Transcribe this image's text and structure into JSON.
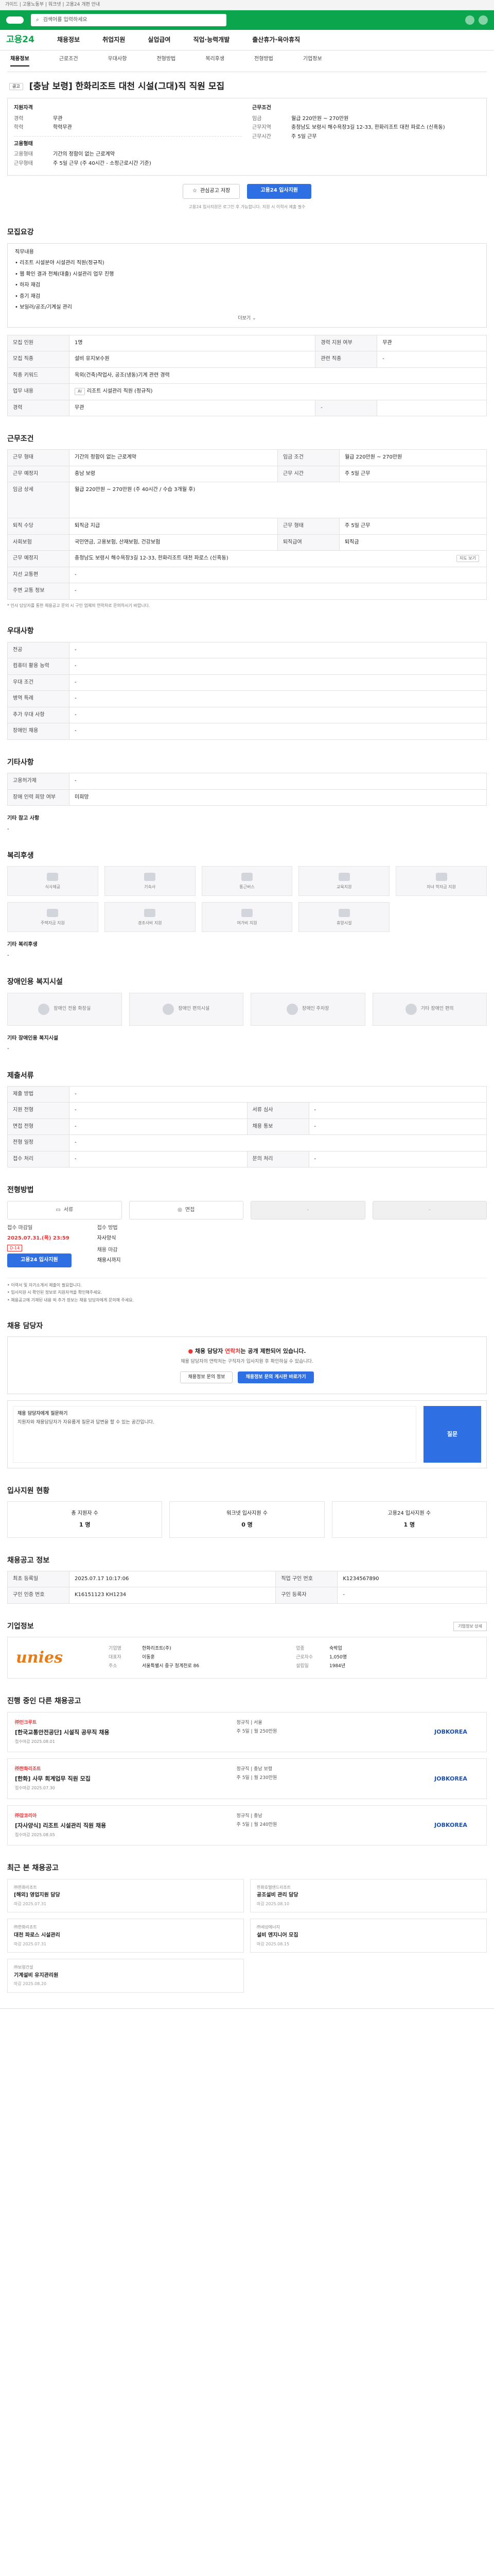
{
  "topbar": {
    "text": "가이드 | 고용노동부 | 워크넷 | 고용24 개편 안내"
  },
  "gnb": {
    "search_placeholder": "검색어를 입력하세요"
  },
  "nav": {
    "brand": "고용24",
    "items": [
      "채용정보",
      "취업지원",
      "실업급여",
      "직업·능력개발",
      "출산휴가·육아휴직"
    ]
  },
  "tabs": [
    "채용정보",
    "근로조건",
    "우대사항",
    "전형방법",
    "복리후생",
    "전형방법",
    "기업정보"
  ],
  "job": {
    "badge": "공고",
    "title": "[충남 보령] 한화리조트 대천 시설(그대)직 직원 모집",
    "left": {
      "heading": "지원자격",
      "rows": [
        [
          "경력",
          "무관"
        ],
        [
          "학력",
          "학력무관"
        ]
      ],
      "heading2": "고용형태",
      "rows2": [
        [
          "고용형태",
          "기간의 정함이 없는 근로계약"
        ],
        [
          "근무형태",
          "주 5일 근무 (주 40시간 - 소정근로시간 기준)"
        ]
      ]
    },
    "right": {
      "heading": "근무조건",
      "rows": [
        [
          "임금",
          "월급 220만원 ~ 270만원"
        ],
        [
          "근무지역",
          "충청남도 보령시 해수욕장3길 12-33, 한화리조트 대천 파로스 (신흑동)"
        ],
        [
          "근무시간",
          "주 5일 근무"
        ]
      ]
    }
  },
  "actions": {
    "save": "관심공고 저장",
    "apply": "고용24 입사지원"
  },
  "notice_line": "고용24 입사지원은 로그인 후 가능합니다. 지원 시 이력서 제출 필수",
  "recruit": {
    "title": "모집요강",
    "bullets": [
      "직무내용",
      "• 리조트 시설분야 시설관리 직원(정규직)",
      "• 웹 확인 결과 전체(대출) 시설관리 업무 진행",
      "• 하자 재검",
      "• 증기 재검",
      "• 보일러/공조/기계실 관리"
    ],
    "more": "더보기",
    "table": [
      [
        "모집 인원",
        "1명",
        "경력 지원 여부",
        "무관"
      ],
      [
        "모집 직종",
        "설비 유지보수원",
        "관련 직종",
        "-"
      ],
      [
        "직종 키워드",
        "옥외(건축)작업사, 공조(냉동)기계 관련 경력",
        null,
        null
      ],
      [
        "업무 내용",
        "리조트 시설관리 직원 (정규직)",
        null,
        null
      ],
      [
        "경력",
        "무관",
        "-",
        null
      ]
    ]
  },
  "cond": {
    "title": "근무조건",
    "rows": [
      [
        "근무 형태",
        "기간의 정함이 없는 근로계약",
        "임금 조건",
        "월급 220만원 ~ 270만원"
      ],
      [
        "근무 예정지",
        "충남 보령",
        "근무 시간",
        "주 5일 근무"
      ],
      [
        "임금 상세",
        "월급 220만원 ~ 270만원 (주 40시간 / 수습 3개월 후)",
        null,
        null
      ],
      [
        "퇴직 수당",
        "퇴직금 지급",
        "근무 형태",
        "주 5일 근무"
      ],
      [
        "사회보험",
        "국민연금, 고용보험, 산재보험, 건강보험",
        "퇴직급여",
        "퇴직금"
      ],
      [
        "근무 예정지",
        "충청남도 보령시 해수욕장3길 12-33, 한화리조트 대천 파로스 (신흑동)",
        null,
        null
      ],
      [
        "지선 교통편",
        "-",
        null,
        null
      ],
      [
        "주변 교통 정보",
        "-",
        null,
        null
      ]
    ],
    "map_btn": "지도 보기",
    "note": "* 인사 담당자를 통한 채용공고 문의 시 구인 업체의 연락처로 문의하시기 바랍니다."
  },
  "pref": {
    "title": "우대사항",
    "rows": [
      [
        "전공",
        "-"
      ],
      [
        "컴퓨터 활용 능력",
        "-"
      ],
      [
        "우대 조건",
        "-"
      ],
      [
        "병역 특례",
        "-"
      ],
      [
        "추가 우대 사항",
        "-"
      ],
      [
        "장애인 채용",
        "-"
      ]
    ]
  },
  "extra": {
    "title": "기타사항",
    "rows": [
      [
        "고용허가제",
        "-"
      ],
      [
        "장애 인력 희망 여부",
        "미희망"
      ]
    ],
    "sub": "기타 참고 사항",
    "dash": "-"
  },
  "welfare": {
    "title": "복리후생",
    "items": [
      "식사제공",
      "기숙사",
      "통근버스",
      "교육지원",
      "자녀 학자금 지원",
      "주택자금 지원",
      "경조사비 지원",
      "여가비 지원",
      "휴양시설"
    ],
    "sub": "기타 복리후생",
    "dash": "-"
  },
  "disab": {
    "title": "장애인용 복지시설",
    "items": [
      "장애인 전용 화장실",
      "장애인 편의시설",
      "장애인 주차장",
      "기타 장애인 편의"
    ],
    "sub": "기타 장애인용 복지시설",
    "dash": "-"
  },
  "apply": {
    "title": "제출서류",
    "rows": [
      [
        "제출 방법",
        "-",
        "",
        ""
      ],
      [
        "지원 전형",
        "-",
        "서류 심사",
        "-"
      ],
      [
        "면접 전형",
        "-",
        "채용 통보",
        "-"
      ],
      [
        "전형 일정",
        "-",
        "",
        ""
      ],
      [
        "접수 처리",
        "-",
        "문의 처리",
        "-"
      ]
    ]
  },
  "select": {
    "title": "전형방법",
    "boxes": [
      "서류",
      "면접",
      "-",
      "-"
    ]
  },
  "deadline": {
    "lbl1": "접수 마감일",
    "val1": "2025.07.31.(목) 23:59",
    "tag": "D-14",
    "btn": "고용24 입사지원",
    "lbl2": "접수 방법",
    "val2": "자사양식",
    "lbl3": "채용 마감",
    "val3": "채용시까지",
    "bullets": [
      "• 이력서 및 자기소개서 제출이 필요합니다.",
      "• 입사지원 시 확인된 정보로 지원자격을 확인해주세요.",
      "• 채용공고에 기재된 내용 외 추가 정보는 채용 담당자에게 문의해 주세요."
    ]
  },
  "contact": {
    "title": "채용 담당자",
    "warn_pre": "채용 담당자",
    "warn_red": "연락처",
    "warn_post": "는 공개 제한되어 있습니다.",
    "sub": "채용 담당자의 연락처는 구직자가 입사지원 후 확인하실 수 있습니다.",
    "btn1": "채용정보 문의 정보",
    "btn2": "채용정보 문의 게시판 바로가기",
    "q_label": "채용 담당자에게 질문하기",
    "q_text": "지원자와 채용담당자가 자유롭게 질문과 답변을 할 수 있는 공간입니다.",
    "q_btn": "질문"
  },
  "stats": {
    "title": "입사지원 현황",
    "items": [
      [
        "총 지원자 수",
        "1 명"
      ],
      [
        "워크넷 입사지원 수",
        "0 명"
      ],
      [
        "고용24 입사지원 수",
        "1 명"
      ]
    ]
  },
  "posting": {
    "title": "채용공고 정보",
    "rows": [
      [
        "최초 등록일",
        "2025.07.17 10:17:06",
        "직업 구인 번호",
        "K1234567890"
      ],
      [
        "구인 인증 번호",
        "K16151123 KH1234",
        "구인 등록자",
        "-"
      ]
    ]
  },
  "company": {
    "title": "기업정보",
    "btn": "기업정보 상세",
    "logo": "unies",
    "info": [
      [
        "기업명",
        "한화리조트(주)",
        "업종",
        "숙박업"
      ],
      [
        "대표자",
        "이동훈",
        "근로자수",
        "1,050명"
      ],
      [
        "주소",
        "서울특별시 중구 청계천로 86",
        "설립일",
        "1984년"
      ]
    ]
  },
  "similar": {
    "title": "진행 중인 다른 채용공고",
    "jobs": [
      {
        "co": "㈜인크루트",
        "title": "[한국교통안전공단] 시설직 공무직 채용",
        "d": "접수마감 2025.08.01",
        "m": [
          "정규직 | 서울",
          "주 5일 | 월 250만원"
        ],
        "logo": "JOBKOREA"
      },
      {
        "co": "㈜한화리조트",
        "title": "[한화] 사무 회계업무 직원 모집",
        "d": "접수마감 2025.07.30",
        "m": [
          "정규직 | 충남 보령",
          "주 5일 | 월 230만원"
        ],
        "logo": "JOBKOREA"
      },
      {
        "co": "㈜잡코리아",
        "title": "[자사양식] 리조트 시설관리 직원 채용",
        "d": "접수마감 2025.08.05",
        "m": [
          "정규직 | 충남",
          "주 5일 | 월 240만원"
        ],
        "logo": "JOBKOREA"
      }
    ]
  },
  "recent": {
    "title": "최근 본 채용공고",
    "items": [
      {
        "c": "㈜한화리조트",
        "t": "[해외] 영업지원 담당",
        "d": "마감 2025.07.31"
      },
      {
        "c": "한화호텔앤드리조트",
        "t": "공조설비 관리 담당",
        "d": "마감 2025.08.10"
      },
      {
        "c": "㈜한화리조트",
        "t": "대천 파로스 시설관리",
        "d": "마감 2025.07.31"
      },
      {
        "c": "㈜세성에너지",
        "t": "설비 엔지니어 모집",
        "d": "마감 2025.08.15"
      },
      {
        "c": "㈜보령건설",
        "t": "기계설비 유지관리원",
        "d": "마감 2025.08.20"
      }
    ]
  }
}
